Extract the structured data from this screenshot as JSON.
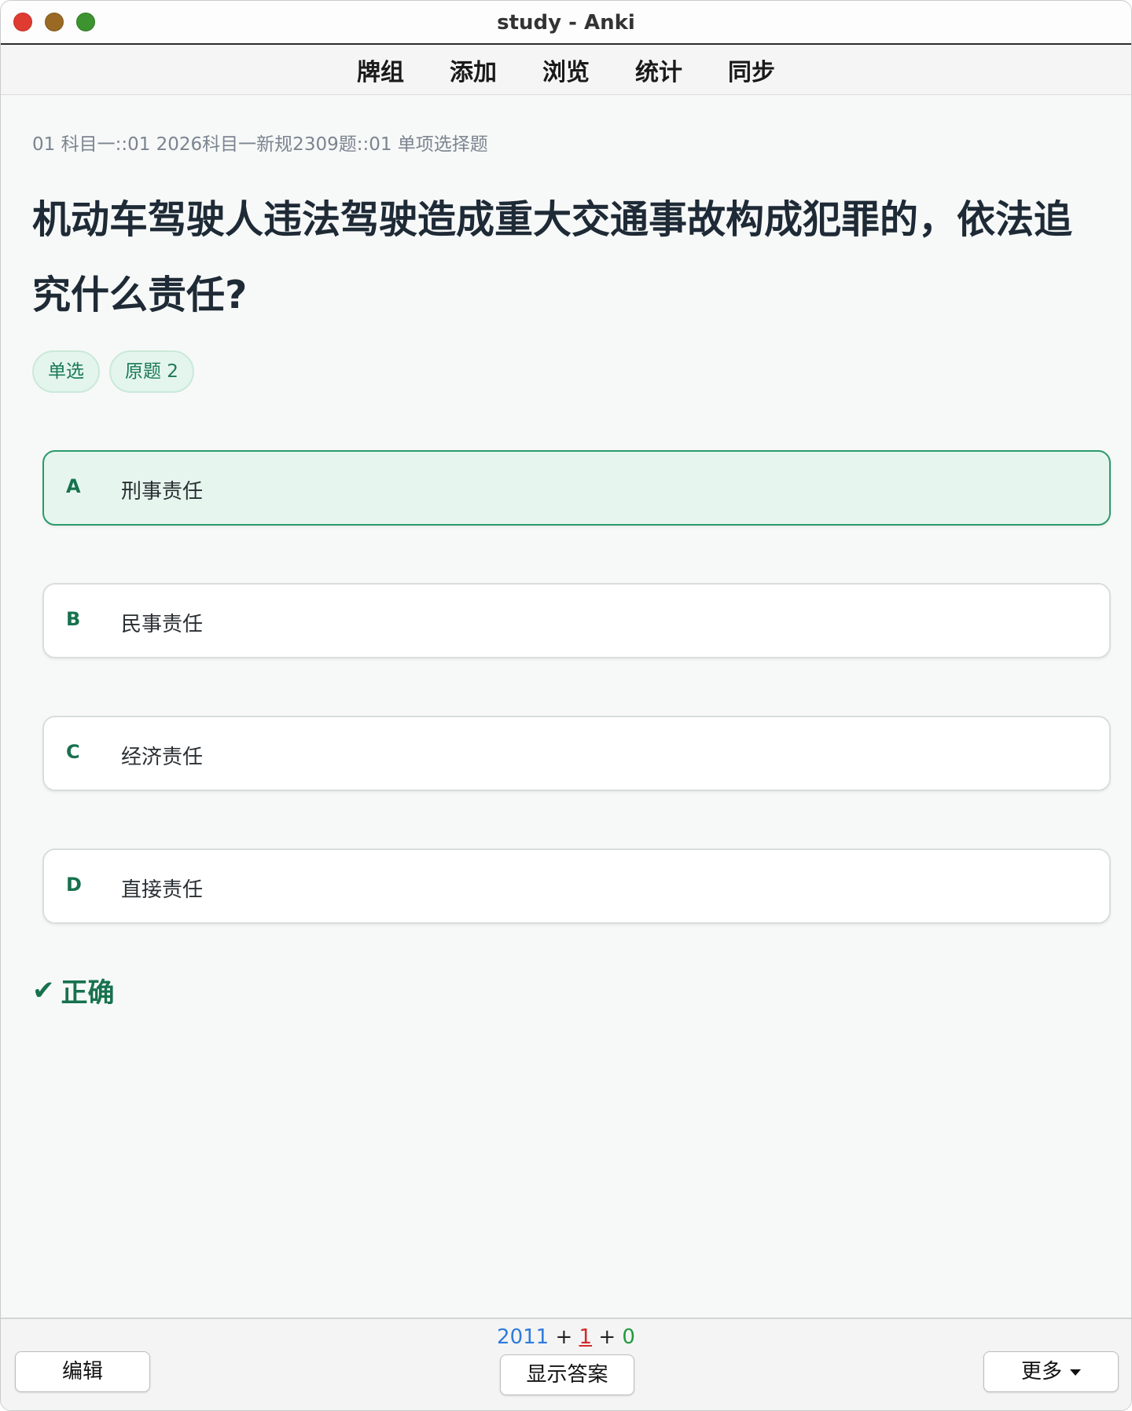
{
  "window": {
    "title": "study - Anki"
  },
  "toolbar": {
    "items": [
      "牌组",
      "添加",
      "浏览",
      "统计",
      "同步"
    ]
  },
  "card": {
    "deck_path": "01 科目一::01 2026科目一新规2309题::01 单项选择题",
    "question": "机动车驾驶人违法驾驶造成重大交通事故构成犯罪的，依法追究什么责任?",
    "tags": [
      "单选",
      "原题 2"
    ],
    "options": [
      {
        "letter": "A",
        "text": "刑事责任",
        "selected": true
      },
      {
        "letter": "B",
        "text": "民事责任",
        "selected": false
      },
      {
        "letter": "C",
        "text": "经济责任",
        "selected": false
      },
      {
        "letter": "D",
        "text": "直接责任",
        "selected": false
      }
    ],
    "result": "正确",
    "result_icon": "check-icon"
  },
  "bottom": {
    "counts": {
      "new": "2011",
      "learn": "1",
      "review": "0",
      "sep": "+"
    },
    "edit_label": "编辑",
    "show_answer_label": "显示答案",
    "more_label": "更多"
  },
  "colors": {
    "accent": "#17724e",
    "selected_bg": "#e6f6ee",
    "new_count": "#2f7bdc",
    "learn_count": "#d32a2a",
    "review_count": "#1f9a3f"
  }
}
